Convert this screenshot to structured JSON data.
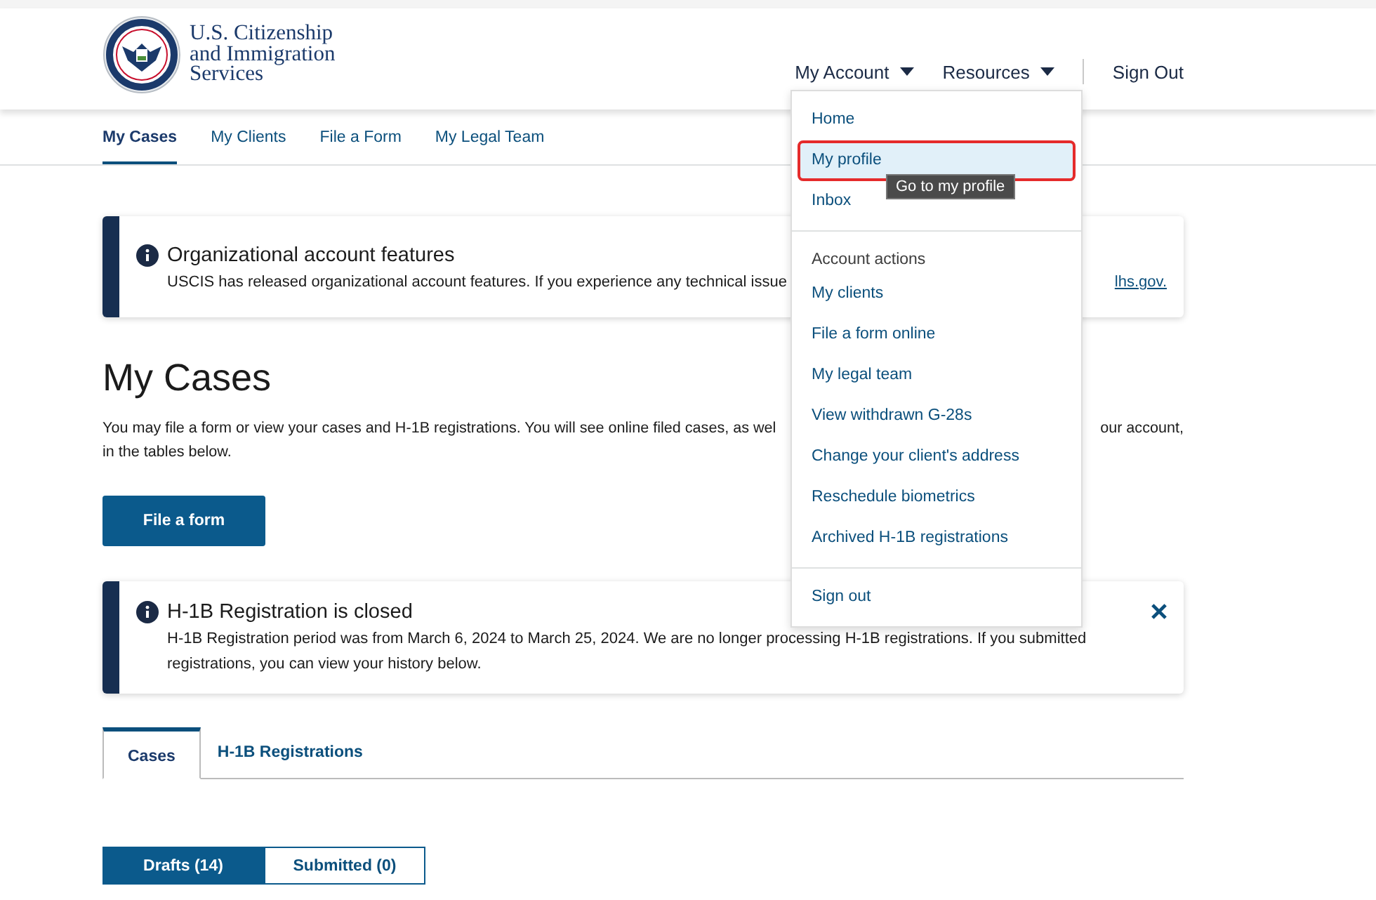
{
  "header": {
    "agency_name": [
      "U.S. Citizenship",
      "and Immigration",
      "Services"
    ],
    "nav": [
      {
        "label": "My Account",
        "kind": "menu"
      },
      {
        "label": "Resources",
        "kind": "menu"
      },
      {
        "label": "Sign Out",
        "kind": "link"
      }
    ]
  },
  "subnav": [
    {
      "label": "My Cases",
      "selected": true
    },
    {
      "label": "My Clients",
      "selected": false
    },
    {
      "label": "File a Form",
      "selected": false
    },
    {
      "label": "My Legal Team",
      "selected": false
    }
  ],
  "alerts": [
    {
      "title": "Organizational account features",
      "lines": [
        [
          "USCIS has released organizational account features. If you experience any technical issue",
          "lhs.gov."
        ]
      ],
      "dismissible": false
    },
    {
      "title": "H-1B Registration is closed",
      "lines": [
        [
          "H-1B Registration period was from March 6, 2024 to March 25, 2024. We are no longer processing H-1B registrations. If you submitted"
        ],
        [
          "registrations, you can view your history below."
        ]
      ],
      "dismissible": true
    }
  ],
  "heading": "My Cases",
  "intro": [
    [
      "You may file a form or view your cases and H-1B registrations. You will see online filed cases, as wel",
      "our account,"
    ],
    [
      "in the tables below."
    ]
  ],
  "primary_button": "File a form",
  "tabs": [
    {
      "label": "Cases",
      "selected": true
    },
    {
      "label": "H-1B Registrations",
      "selected": false
    }
  ],
  "toggle": [
    {
      "label": "Drafts (14)",
      "selected": true
    },
    {
      "label": "Submitted (0)",
      "selected": false
    }
  ],
  "account_menu": {
    "groups": [
      {
        "items": [
          {
            "label": "Home",
            "selected": false
          },
          {
            "label": "My profile",
            "selected": true
          },
          {
            "label": "Inbox",
            "selected": false
          }
        ]
      },
      {
        "heading": "Account actions",
        "items": [
          {
            "label": "My clients",
            "selected": false
          },
          {
            "label": "File a form online",
            "selected": false
          },
          {
            "label": "My legal team",
            "selected": false
          },
          {
            "label": "View withdrawn G-28s",
            "selected": false
          },
          {
            "label": "Change your client's address",
            "selected": false
          },
          {
            "label": "Reschedule biometrics",
            "selected": false
          },
          {
            "label": "Archived H-1B registrations",
            "selected": false
          }
        ]
      },
      {
        "items": [
          {
            "label": "Sign out",
            "selected": false
          }
        ]
      }
    ],
    "tooltip": "Go to my profile"
  }
}
